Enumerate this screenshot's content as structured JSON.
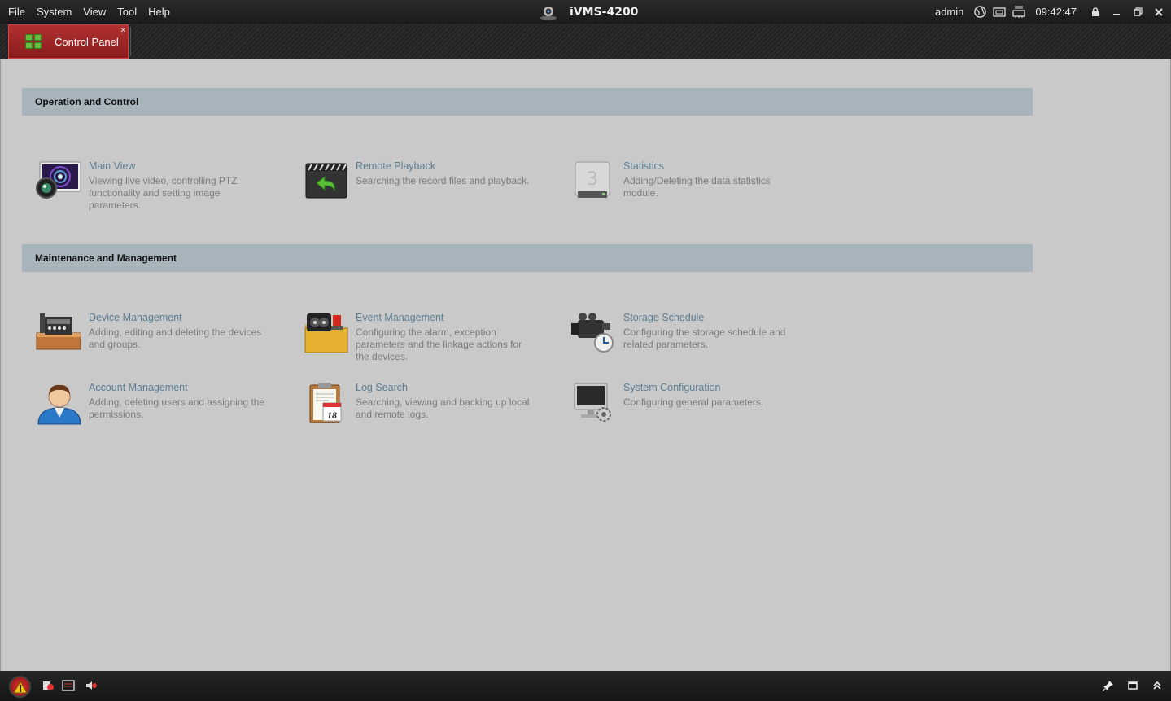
{
  "menu": {
    "items": [
      {
        "label": "File"
      },
      {
        "label": "System"
      },
      {
        "label": "View"
      },
      {
        "label": "Tool"
      },
      {
        "label": "Help"
      }
    ]
  },
  "app": {
    "title": "iVMS-4200"
  },
  "system_tray": {
    "user": "admin",
    "time": "09:42:47",
    "icons": [
      "globe-icon",
      "cpu-icon",
      "ram-icon",
      "lock-icon"
    ],
    "window_buttons": [
      "minimize",
      "restore",
      "close"
    ]
  },
  "tabs": [
    {
      "label": "Control Panel",
      "active": true,
      "icon": "control-panel-icon"
    }
  ],
  "sections": [
    {
      "title": "Operation and Control",
      "modules": [
        {
          "title": "Main View",
          "description": "Viewing live video, controlling PTZ functionality and setting image parameters.",
          "icon": "main-view-icon"
        },
        {
          "title": "Remote Playback",
          "description": "Searching the record files and playback.",
          "icon": "remote-playback-icon"
        },
        {
          "title": "Statistics",
          "description": "Adding/Deleting the data statistics module.",
          "icon": "statistics-icon"
        }
      ]
    },
    {
      "title": "Maintenance and Management",
      "modules": [
        {
          "title": "Device Management",
          "description": "Adding, editing and deleting the devices and groups.",
          "icon": "device-management-icon"
        },
        {
          "title": "Event Management",
          "description": "Configuring the alarm, exception parameters and the linkage actions for the devices.",
          "icon": "event-management-icon"
        },
        {
          "title": "Storage Schedule",
          "description": "Configuring the storage schedule and related parameters.",
          "icon": "storage-schedule-icon"
        },
        {
          "title": "Account Management",
          "description": "Adding, deleting users and assigning the permissions.",
          "icon": "account-management-icon"
        },
        {
          "title": "Log Search",
          "description": "Searching, viewing and backing up local and remote logs.",
          "icon": "log-search-icon",
          "calendar_day": "18"
        },
        {
          "title": "System Configuration",
          "description": "Configuring general parameters.",
          "icon": "system-configuration-icon"
        }
      ]
    }
  ],
  "statusbar": {
    "icons": [
      "alarm-icon",
      "alarm-output-icon",
      "event-icon",
      "mute-icon",
      "pin-icon",
      "window-icon",
      "expand-icon"
    ]
  },
  "colors": {
    "accent_red": "#a82626",
    "section_header": "#a8b4bb",
    "module_title": "#5c7e93",
    "background": "#c9c9c9"
  }
}
